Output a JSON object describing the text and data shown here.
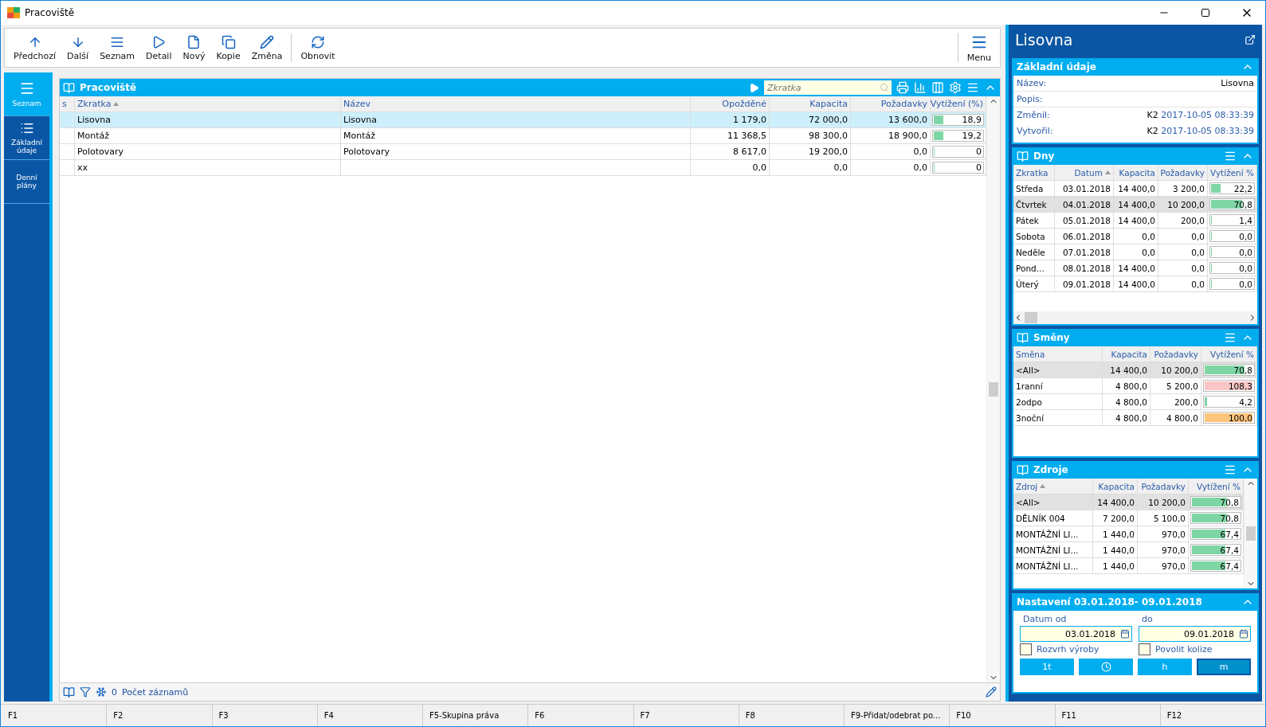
{
  "window": {
    "title": "Pracoviště"
  },
  "toolbar": {
    "buttons": [
      {
        "kind": "up",
        "label": "Předchozí"
      },
      {
        "kind": "down",
        "label": "Další"
      },
      {
        "kind": "list",
        "label": "Seznam"
      },
      {
        "kind": "play",
        "label": "Detail"
      },
      {
        "kind": "file",
        "label": "Nový"
      },
      {
        "kind": "copy",
        "label": "Kopie"
      },
      {
        "kind": "pencil",
        "label": "Změna"
      },
      {
        "kind": "refresh",
        "label": "Obnovit"
      }
    ],
    "menu": {
      "label": "Menu"
    }
  },
  "nav": [
    {
      "kind": "hamburger",
      "label": "Seznam",
      "selected": true
    },
    {
      "kind": "list",
      "label": "Základní údaje",
      "selected": false
    },
    {
      "kind": "text",
      "label": "Denní plány",
      "selected": false
    }
  ],
  "grid": {
    "title": "Pracoviště",
    "search": {
      "placeholder": "Zkratka"
    },
    "columns": [
      {
        "label": "s",
        "sorted": false
      },
      {
        "label": "Zkratka",
        "sorted": true
      },
      {
        "label": "Název",
        "sorted": false
      },
      {
        "label": "Opožděné",
        "sorted": false
      },
      {
        "label": "Kapacita",
        "sorted": false
      },
      {
        "label": "Požadavky",
        "sorted": false
      },
      {
        "label": "Vytížení (%)",
        "sorted": false
      }
    ],
    "rows": [
      {
        "selected": true,
        "cells": [
          "",
          "Lisovna",
          "Lisovna",
          "1 179,0",
          "72 000,0",
          "13 600,0"
        ],
        "util": {
          "reading": "18,9",
          "level": 0.189,
          "color": "#7fd6a5"
        }
      },
      {
        "selected": false,
        "cells": [
          "",
          "Montáž",
          "Montáž",
          "11 368,5",
          "98 300,0",
          "18 900,0"
        ],
        "util": {
          "reading": "19,2",
          "level": 0.192,
          "color": "#7fd6a5"
        }
      },
      {
        "selected": false,
        "cells": [
          "",
          "Polotovary",
          "Polotovary",
          "8 617,0",
          "19 200,0",
          "0,0"
        ],
        "util": {
          "reading": "0",
          "level": 0,
          "color": "#7fd6a5"
        }
      },
      {
        "selected": false,
        "cells": [
          "",
          "xx",
          "",
          "0,0",
          "0,0",
          "0,0"
        ],
        "util": {
          "reading": "0",
          "level": 0,
          "color": "#7fd6a5"
        }
      }
    ],
    "footer": {
      "count": "0",
      "label": "Počet záznamů"
    }
  },
  "detail": {
    "title": "Lisovna",
    "basic": {
      "title": "Základní údaje",
      "fields": [
        {
          "label": "Název:",
          "value": "Lisovna"
        },
        {
          "label": "Popis:"
        },
        {
          "label": "Změnil:",
          "user": "K2",
          "value": "2017-10-05 08:33:39"
        },
        {
          "label": "Vytvořil:",
          "user": "K2",
          "value": "2017-10-05 08:33:39"
        }
      ]
    },
    "days": {
      "title": "Dny",
      "columns": [
        {
          "label": "Zkratka",
          "sorted": false
        },
        {
          "label": "Datum",
          "sorted": true
        },
        {
          "label": "Kapacita",
          "sorted": false
        },
        {
          "label": "Požadavky",
          "sorted": false
        },
        {
          "label": "Vytížení %",
          "sorted": false
        }
      ],
      "rows": [
        {
          "selected": false,
          "cells": [
            "Středa",
            "03.01.2018",
            "14 400,0",
            "3 200,0"
          ],
          "util": {
            "reading": "22,2",
            "level": 0.222,
            "color": "#7fd6a5"
          }
        },
        {
          "selected": true,
          "cells": [
            "Čtvrtek",
            "04.01.2018",
            "14 400,0",
            "10 200,0"
          ],
          "util": {
            "reading": "70,8",
            "level": 0.708,
            "color": "#7fd6a5"
          }
        },
        {
          "selected": false,
          "cells": [
            "Pátek",
            "05.01.2018",
            "14 400,0",
            "200,0"
          ],
          "util": {
            "reading": "1,4",
            "level": 0.014,
            "color": "#7fd6a5"
          }
        },
        {
          "selected": false,
          "cells": [
            "Sobota",
            "06.01.2018",
            "0,0",
            "0,0"
          ],
          "util": {
            "reading": "0,0",
            "level": 0,
            "color": "#7fd6a5"
          }
        },
        {
          "selected": false,
          "cells": [
            "Neděle",
            "07.01.2018",
            "0,0",
            "0,0"
          ],
          "util": {
            "reading": "0,0",
            "level": 0,
            "color": "#7fd6a5"
          }
        },
        {
          "selected": false,
          "cells": [
            "Pond...",
            "08.01.2018",
            "14 400,0",
            "0,0"
          ],
          "util": {
            "reading": "0,0",
            "level": 0,
            "color": "#7fd6a5"
          }
        },
        {
          "selected": false,
          "cells": [
            "Úterý",
            "09.01.2018",
            "14 400,0",
            "0,0"
          ],
          "util": {
            "reading": "0,0",
            "level": 0,
            "color": "#7fd6a5"
          }
        }
      ]
    },
    "shifts": {
      "title": "Směny",
      "columns": [
        {
          "label": "Směna",
          "sorted": false
        },
        {
          "label": "Kapacita",
          "sorted": false
        },
        {
          "label": "Požadavky",
          "sorted": false
        },
        {
          "label": "Vytížení %",
          "sorted": false
        }
      ],
      "rows": [
        {
          "selected": true,
          "cells": [
            "<All>",
            "14 400,0",
            "10 200,0"
          ],
          "util": {
            "reading": "70,8",
            "level": 0.8,
            "color": "#7fd6a5"
          }
        },
        {
          "selected": false,
          "cells": [
            "1ranní",
            "4 800,0",
            "5 200,0"
          ],
          "util": {
            "reading": "108,3",
            "level": 1,
            "color": "#f9c6c6"
          }
        },
        {
          "selected": false,
          "cells": [
            "2odpo",
            "4 800,0",
            "200,0"
          ],
          "util": {
            "reading": "4,2",
            "level": 0.042,
            "color": "#7fd6a5"
          }
        },
        {
          "selected": false,
          "cells": [
            "3noční",
            "4 800,0",
            "4 800,0"
          ],
          "util": {
            "reading": "100,0",
            "level": 1,
            "color": "#fdc57c"
          }
        }
      ]
    },
    "resources": {
      "title": "Zdroje",
      "columns": [
        {
          "label": "Zdroj",
          "sorted": true
        },
        {
          "label": "Kapacita",
          "sorted": false
        },
        {
          "label": "Požadavky",
          "sorted": false
        },
        {
          "label": "Vytížení %",
          "sorted": false
        }
      ],
      "rows": [
        {
          "selected": true,
          "cells": [
            "<All>",
            "14 400,0",
            "10 200,0"
          ],
          "util": {
            "reading": "70,8",
            "level": 0.708,
            "color": "#7fd6a5"
          }
        },
        {
          "selected": false,
          "cells": [
            "DĚLNÍK 004",
            "7 200,0",
            "5 100,0"
          ],
          "util": {
            "reading": "70,8",
            "level": 0.708,
            "color": "#7fd6a5"
          }
        },
        {
          "selected": false,
          "cells": [
            "MONTÁŽNÍ LI...",
            "1 440,0",
            "970,0"
          ],
          "util": {
            "reading": "67,4",
            "level": 0.674,
            "color": "#7fd6a5"
          }
        },
        {
          "selected": false,
          "cells": [
            "MONTÁŽNÍ LI...",
            "1 440,0",
            "970,0"
          ],
          "util": {
            "reading": "67,4",
            "level": 0.674,
            "color": "#7fd6a5"
          }
        },
        {
          "selected": false,
          "cells": [
            "MONTÁŽNÍ LI...",
            "1 440,0",
            "970,0"
          ],
          "util": {
            "reading": "67,4",
            "level": 0.674,
            "color": "#7fd6a5"
          }
        }
      ]
    },
    "settings": {
      "title": "Nastavení 03.01.2018- 09.01.2018",
      "from": {
        "label": "Datum od",
        "value": "03.01.2018"
      },
      "to": {
        "label": "do",
        "value": "09.01.2018"
      },
      "checkboxes": [
        {
          "label": "Rozvrh výroby",
          "checked": false
        },
        {
          "label": "Povolit kolize",
          "checked": false
        }
      ],
      "buttons": [
        {
          "kind": "text",
          "label": "1t",
          "selected": false
        },
        {
          "kind": "clock",
          "selected": false
        },
        {
          "kind": "text",
          "label": "h",
          "selected": false
        },
        {
          "kind": "text",
          "label": "m",
          "selected": true
        }
      ]
    }
  },
  "status_bar": [
    "F1",
    "F2",
    "F3",
    "F4",
    "F5-Skupina práva",
    "F6",
    "F7",
    "F8",
    "F9-Přidat/odebrat po...",
    "F10",
    "F11",
    "F12"
  ]
}
